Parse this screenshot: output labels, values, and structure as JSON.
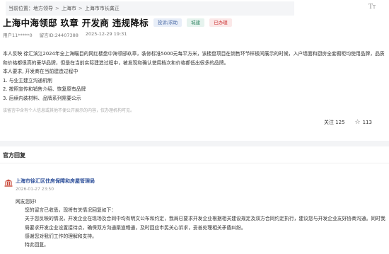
{
  "breadcrumb": {
    "items": [
      "当前位置：",
      "地方领导",
      "上海市",
      "上海市市长龚正"
    ]
  },
  "title": "上海中海领邸 玖章 开发商 违规降标",
  "tags": [
    "投诉/求助",
    "城建",
    "已办理"
  ],
  "meta": {
    "user": "用户11*****0",
    "message_id": "留言ID:24407388",
    "datetime": "2025-12-29 19:31"
  },
  "content": {
    "para1": "本人反映 徐汇滨江2024年全上海瞩目的网红楼盘中海领邸玖章，装修标准5000元每平方米，该楼盘项目在销售环节样板间展示的时候，入户墙面和厨房全套橱柜均使用品牌，品质和价格都很高的豪华品牌，但是在当前实际建造过程中，被发现和确认使用档次和价格都低出很多的品牌。",
    "para2": "本人要求, 开发商在当前建造过程中",
    "list": [
      "1. 与业主建立沟通机制",
      "2. 按照宣传和销售介绍、恢复原有品牌",
      "3. 后续内装材料、品牌系列需要公示"
    ],
    "note": "该留言中含有个人信息或其他不便公开展示的内容，仅办理机构可见。"
  },
  "actions": {
    "follow_label": "关注",
    "follow_count": "125",
    "star_count": "113"
  },
  "reply": {
    "section_title": "官方回复",
    "org_name": "上海市徐汇区住房保障和房屋管理局",
    "date": "2026-01-27 23:50",
    "greeting": "网友您好!",
    "line1": "您的留言已收悉，现将有关情况回复如下：",
    "line2": "关于您反映的情况，开发企业在现场及合同中均有明文公布和约定，我局已要求开发企业根据相关建设规定及双方合同约定执行，建议您与开发企业友好协商沟通。同时我局要求开发企业设置接待点，确保双方沟通渠道畅通，及时回应市民关心诉求，妥善处理相关矛盾纠纷。",
    "line3": "感谢您对我们工作的理解和支持。",
    "line4": "特此回复。"
  },
  "colors": {
    "org_blue": "#2d4f9a",
    "tag_red": "#cc3333"
  }
}
